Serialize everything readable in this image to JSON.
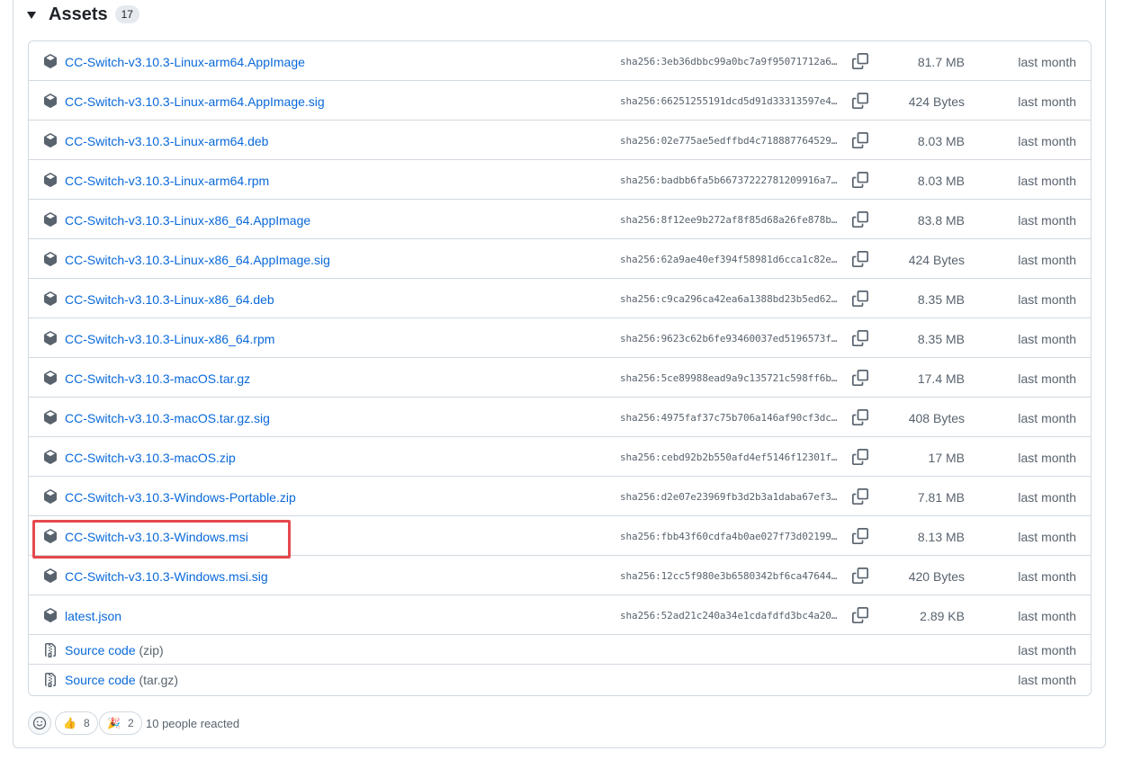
{
  "assets": {
    "title": "Assets",
    "count": "17",
    "files": [
      {
        "name": "CC-Switch-v3.10.3-Linux-arm64.AppImage",
        "sha": "sha256:3eb36dbbc99a0bc7a9f95071712a6…",
        "size": "81.7 MB",
        "date": "last month"
      },
      {
        "name": "CC-Switch-v3.10.3-Linux-arm64.AppImage.sig",
        "sha": "sha256:66251255191dcd5d91d33313597e4…",
        "size": "424 Bytes",
        "date": "last month"
      },
      {
        "name": "CC-Switch-v3.10.3-Linux-arm64.deb",
        "sha": "sha256:02e775ae5edffbd4c718887764529…",
        "size": "8.03 MB",
        "date": "last month"
      },
      {
        "name": "CC-Switch-v3.10.3-Linux-arm64.rpm",
        "sha": "sha256:badbb6fa5b66737222781209916a7…",
        "size": "8.03 MB",
        "date": "last month"
      },
      {
        "name": "CC-Switch-v3.10.3-Linux-x86_64.AppImage",
        "sha": "sha256:8f12ee9b272af8f85d68a26fe878b…",
        "size": "83.8 MB",
        "date": "last month"
      },
      {
        "name": "CC-Switch-v3.10.3-Linux-x86_64.AppImage.sig",
        "sha": "sha256:62a9ae40ef394f58981d6cca1c82e…",
        "size": "424 Bytes",
        "date": "last month"
      },
      {
        "name": "CC-Switch-v3.10.3-Linux-x86_64.deb",
        "sha": "sha256:c9ca296ca42ea6a1388bd23b5ed62…",
        "size": "8.35 MB",
        "date": "last month"
      },
      {
        "name": "CC-Switch-v3.10.3-Linux-x86_64.rpm",
        "sha": "sha256:9623c62b6fe93460037ed5196573f…",
        "size": "8.35 MB",
        "date": "last month"
      },
      {
        "name": "CC-Switch-v3.10.3-macOS.tar.gz",
        "sha": "sha256:5ce89988ead9a9c135721c598ff6b…",
        "size": "17.4 MB",
        "date": "last month"
      },
      {
        "name": "CC-Switch-v3.10.3-macOS.tar.gz.sig",
        "sha": "sha256:4975faf37c75b706a146af90cf3dc…",
        "size": "408 Bytes",
        "date": "last month"
      },
      {
        "name": "CC-Switch-v3.10.3-macOS.zip",
        "sha": "sha256:cebd92b2b550afd4ef5146f12301f…",
        "size": "17 MB",
        "date": "last month"
      },
      {
        "name": "CC-Switch-v3.10.3-Windows-Portable.zip",
        "sha": "sha256:d2e07e23969fb3d2b3a1daba67ef3…",
        "size": "7.81 MB",
        "date": "last month"
      },
      {
        "name": "CC-Switch-v3.10.3-Windows.msi",
        "sha": "sha256:fbb43f60cdfa4b0ae027f73d02199…",
        "size": "8.13 MB",
        "date": "last month"
      },
      {
        "name": "CC-Switch-v3.10.3-Windows.msi.sig",
        "sha": "sha256:12cc5f980e3b6580342bf6ca47644…",
        "size": "420 Bytes",
        "date": "last month"
      },
      {
        "name": "latest.json",
        "sha": "sha256:52ad21c240a34e1cdafdfd3bc4a20…",
        "size": "2.89 KB",
        "date": "last month"
      }
    ],
    "source": [
      {
        "name": "Source code",
        "suffix": "(zip)",
        "date": "last month"
      },
      {
        "name": "Source code",
        "suffix": "(tar.gz)",
        "date": "last month"
      }
    ]
  },
  "reactions": {
    "items": [
      {
        "emoji": "👍",
        "count": "8"
      },
      {
        "emoji": "🎉",
        "count": "2"
      }
    ],
    "summary": "10 people reacted"
  },
  "colors": {
    "link": "#0969da",
    "muted": "#59636e",
    "border": "#d1d9e0",
    "highlight": "#e5484d"
  }
}
